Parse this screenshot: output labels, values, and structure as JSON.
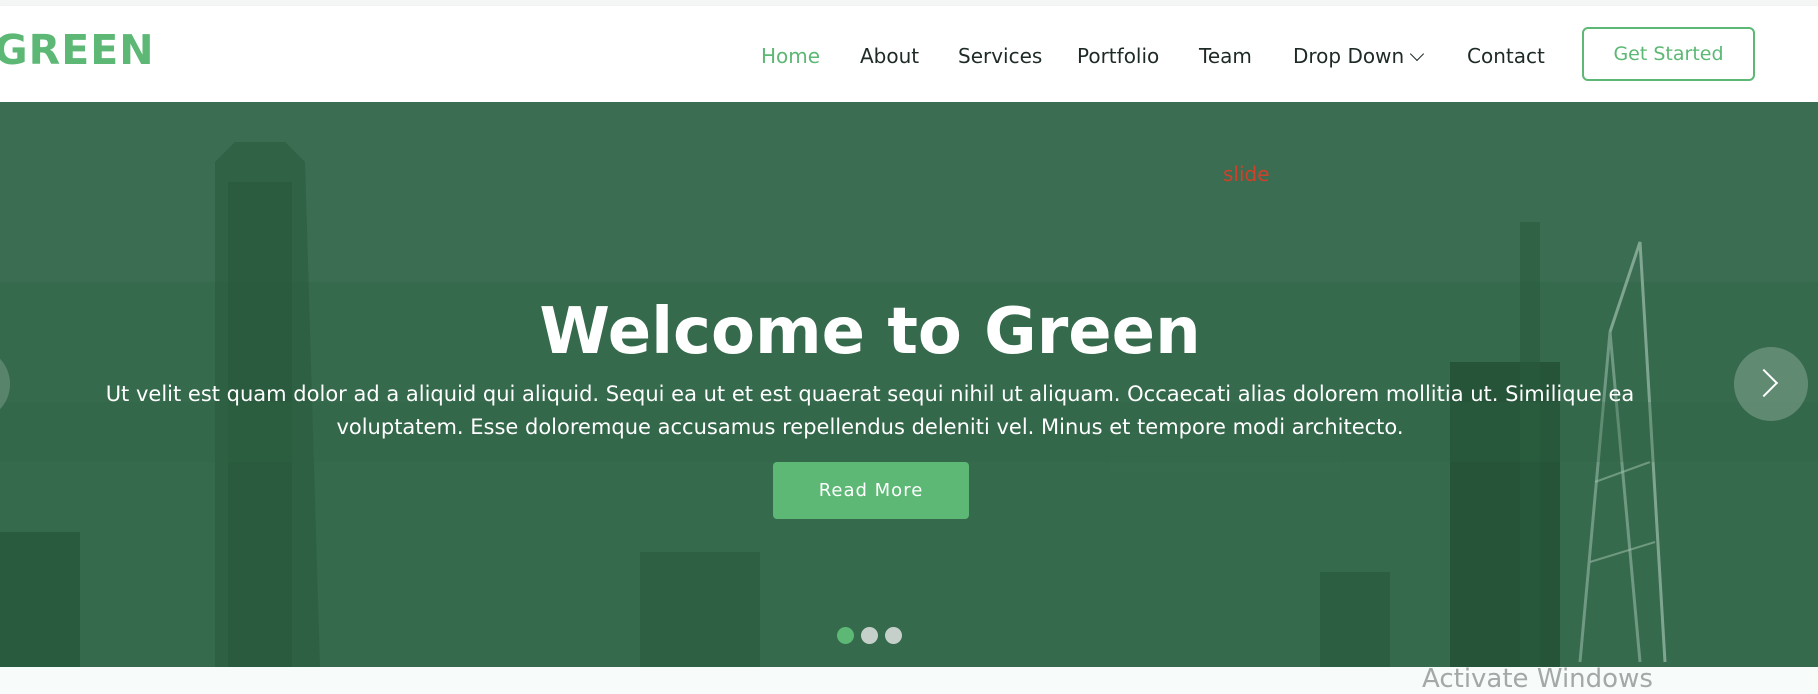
{
  "brand": {
    "logo": "GREEN",
    "accent_color": "#5cb874"
  },
  "nav": {
    "items": [
      {
        "label": "Home",
        "active": true
      },
      {
        "label": "About",
        "active": false
      },
      {
        "label": "Services",
        "active": false
      },
      {
        "label": "Portfolio",
        "active": false
      },
      {
        "label": "Team",
        "active": false
      },
      {
        "label": "Drop Down",
        "active": false,
        "icon": "chevron-down-icon"
      },
      {
        "label": "Contact",
        "active": false
      }
    ],
    "cta_label": "Get Started"
  },
  "hero": {
    "slide_tag": "slide",
    "title": "Welcome to Green",
    "text": "Ut velit est quam dolor ad a aliquid qui aliquid. Sequi ea ut et est quaerat sequi nihil ut aliquam. Occaecati alias dolorem mollitia ut. Similique ea voluptatem. Esse doloremque accusamus repellendus deleniti vel. Minus et tempore modi architecto.",
    "button_label": "Read More",
    "next_icon": "chevron-right-icon",
    "prev_icon": "chevron-left-icon",
    "slides_total": 3,
    "active_slide": 1
  },
  "os": {
    "watermark": "Activate Windows"
  }
}
